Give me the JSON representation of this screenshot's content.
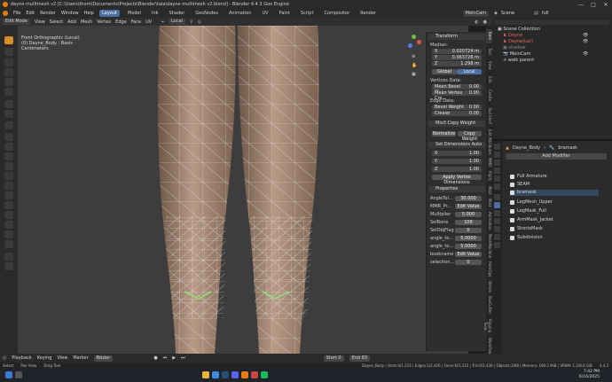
{
  "window": {
    "title": "dayne mulltmesh v2 [C:\\Users\\thorn\\Documents\\Projects\\Blender\\tala\\dayne multimesh v2.blend] - Blender 4.4.3 Goo Engine"
  },
  "menubar": {
    "items": [
      "File",
      "Edit",
      "Render",
      "Window",
      "Help"
    ],
    "workspaces": [
      "Layout",
      "Model",
      "Ink",
      "Shader",
      "GeoNodes",
      "Animation",
      "UV",
      "Paint",
      "Script",
      "Compositor",
      "Render"
    ],
    "active_workspace": "Layout",
    "camera_field": "MeinCam",
    "scene_label": "Scene",
    "viewlayer_label": "full"
  },
  "header3d": {
    "mode": "Edit Mode",
    "items": [
      "View",
      "Select",
      "Add",
      "Mesh",
      "Vertex",
      "Edge",
      "Face",
      "UV"
    ],
    "transform_orientation": "Local"
  },
  "viewport": {
    "view_name": "Front Orthographic (Local)",
    "object_info": "(0) Dayne_Body : Basis",
    "units": "Centimeters"
  },
  "npanel": {
    "transform_header": "Transform",
    "median_label": "Median:",
    "x": {
      "label": "X",
      "value": "0.020724 m"
    },
    "y": {
      "label": "Y",
      "value": "0.063726 m"
    },
    "z": {
      "label": "Z",
      "value": "1.298 m"
    },
    "global_label": "Global",
    "local_label": "Local",
    "vertices_data_label": "Vertices Data:",
    "mean_bevel_weight": {
      "label": "Mean Bevel Wei...",
      "value": "0.00"
    },
    "mean_vertex_crease": {
      "label": "Mean Vertex Cre...",
      "value": "0.00"
    },
    "edge_data_label": "Edge Data:",
    "bevel_weight": {
      "label": "Bevel Weight",
      "value": "0.00"
    },
    "crease": {
      "label": "Crease",
      "value": "0.00"
    },
    "mio3_header": "Mio3 Copy Weight",
    "normalize_label": "Normalize",
    "copy_weight_label": "Copy Weight",
    "setdim_header": "Set Dimensions Auto",
    "dim_x": {
      "label": "X",
      "value": "1.00"
    },
    "dim_y": {
      "label": "Y",
      "value": "1.00"
    },
    "dim_z": {
      "label": "Z",
      "value": "1.00"
    },
    "apply_dims_label": "Apply Vertex Dimensions",
    "properties_header": "Properties",
    "angle_tol": {
      "label": "AngleTol...",
      "value": "30.000"
    },
    "mmr_pr": {
      "label": "MMR_Pr...",
      "value": "Edit Value"
    },
    "multiplier": {
      "label": "Multiplier",
      "value": "5.000"
    },
    "sel_bone": {
      "label": "SelBone",
      "value": "108"
    },
    "sel_obj_flag": {
      "label": "SelObjFlag",
      "value": "0"
    },
    "angle_to": {
      "label": "angle_to...",
      "value": "5.0000"
    },
    "angle_to2": {
      "label": "angle_to...",
      "value": "5.0000"
    },
    "bookname": {
      "label": "bookname",
      "value": "Edit Value"
    },
    "selection": {
      "label": "selection...",
      "value": "0"
    }
  },
  "side_tabs": [
    "Item",
    "Tool",
    "View",
    "Edit",
    "Create",
    "Tool Shelf",
    "Edit Attributes",
    "MMD",
    "Rigify",
    "Mio3",
    "Mio3",
    "Animation",
    "MeshMachine",
    "HardOps",
    "Vertex",
    "BoxCutter",
    "Rigging Tools",
    "Workflow"
  ],
  "outliner": {
    "scene_collection": "Scene Collection",
    "items": [
      {
        "label": "Dayne",
        "color": "#e06a5a"
      },
      {
        "label": "Dayne(tail)",
        "color": "#e06a5a"
      },
      {
        "label": "shadow",
        "color": "#888888"
      },
      {
        "label": "MeinCam",
        "color": "#d6d6d6"
      },
      {
        "label": "walk parent",
        "color": "#d6d6d6"
      }
    ]
  },
  "properties": {
    "object_name": "Dayne_Body",
    "modifier_name_field": "bramask",
    "add_modifier_label": "Add Modifier",
    "modifiers": [
      "Full Armature",
      "SEAM",
      "bramask",
      "LegMesh_Upper",
      "LegMask_Full",
      "ArmMask_Jacket",
      "ShortsMask",
      "Subdivision"
    ]
  },
  "timeline": {
    "items": [
      "Playback",
      "Keying",
      "View",
      "Marker"
    ],
    "interp": "Bézier",
    "start_label": "Start",
    "start_value": "0",
    "end_label": "End",
    "end_value": "83"
  },
  "statusbar": {
    "select": "Select",
    "pan_view": "Pan View",
    "drag_tool": "Drag Tool",
    "stats": "Dayne_Body | Verts:0/1,215 | Edges:1/2,426 | Faces:0/1,215 | Tris:0/2,430 | Objects:1/68 | Memory: 169.2 MiB | VRAM: 1.2/8.0 GiB",
    "version": "4.4.3"
  },
  "taskbar": {
    "time": "7:42 PM",
    "date": "6/16/2025"
  },
  "colors": {
    "accent": "#4b6ea3",
    "active_tool": "#d98c2b",
    "select_green": "#8ee07a"
  }
}
